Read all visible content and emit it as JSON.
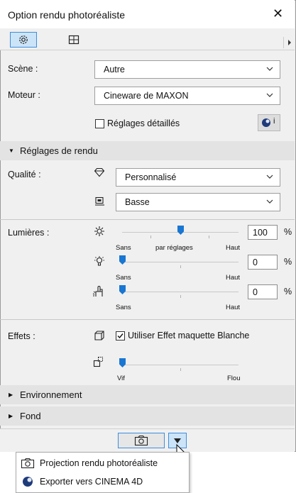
{
  "window": {
    "title": "Option rendu photoréaliste"
  },
  "tabs": [
    {
      "icon": "gear-icon"
    },
    {
      "icon": "crop-frame-icon"
    }
  ],
  "scene": {
    "label": "Scène :",
    "value": "Autre"
  },
  "engine": {
    "label": "Moteur :",
    "value": "Cineware de MAXON"
  },
  "detailed": {
    "label": "Réglages détaillés",
    "checked": false
  },
  "render_section": {
    "label": "Réglages de rendu",
    "expanded": true
  },
  "quality": {
    "label": "Qualité :",
    "preset": "Personnalisé",
    "level": "Basse"
  },
  "lights": {
    "label": "Lumières :",
    "sliders": [
      {
        "icon": "sun-icon",
        "value": "100",
        "unit": "%",
        "fraction": 0.5,
        "left": "Sans",
        "mid": "par réglages",
        "right": "Haut"
      },
      {
        "icon": "bulb-icon",
        "value": "0",
        "unit": "%",
        "fraction": 0.0,
        "left": "Sans",
        "right": "Haut"
      },
      {
        "icon": "hand-light-icon",
        "value": "0",
        "unit": "%",
        "fraction": 0.0,
        "left": "Sans",
        "right": "Haut"
      }
    ]
  },
  "effects": {
    "label": "Effets :",
    "white_model": {
      "label": "Utiliser Effet maquette Blanche",
      "checked": true
    },
    "blur": {
      "fraction": 0.0,
      "left": "Vif",
      "right": "Flou"
    }
  },
  "sections": [
    {
      "label": "Environnement"
    },
    {
      "label": "Fond"
    }
  ],
  "menu": [
    {
      "icon": "camera-icon",
      "label": "Projection rendu photoréaliste"
    },
    {
      "icon": "cinema4d-icon",
      "label": "Exporter vers CINEMA 4D"
    }
  ],
  "colors": {
    "accent": "#1976d2",
    "tab_selected": "#cce4f7"
  }
}
